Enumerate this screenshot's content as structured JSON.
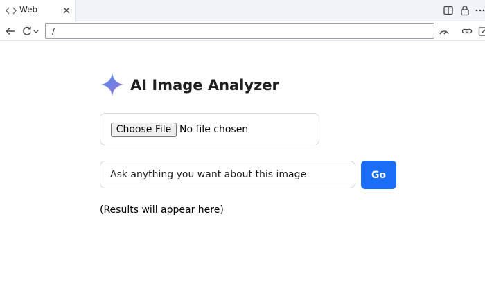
{
  "browser": {
    "tab": {
      "title": "Web",
      "icon": "code-icon"
    },
    "address_bar": {
      "value": "/"
    },
    "window_icons": [
      "split-view-icon",
      "lock-icon",
      "more-icon"
    ],
    "toolbar_icons": [
      "back-arrow-icon",
      "reload-icon",
      "chevron-down-icon",
      "performance-gauge-icon",
      "link-icon",
      "edit-icon"
    ]
  },
  "app": {
    "title": "AI Image Analyzer",
    "logo_icon": "sparkle-icon",
    "file_input": {
      "button_label": "Choose File",
      "status": "No file chosen"
    },
    "prompt": {
      "value": "Ask anything you want about this image"
    },
    "go_label": "Go",
    "results_text": "(Results will appear here)",
    "colors": {
      "accent": "#1a6ef5",
      "sparkle_gradient": [
        "#4c8df6",
        "#9b72cb"
      ]
    }
  }
}
